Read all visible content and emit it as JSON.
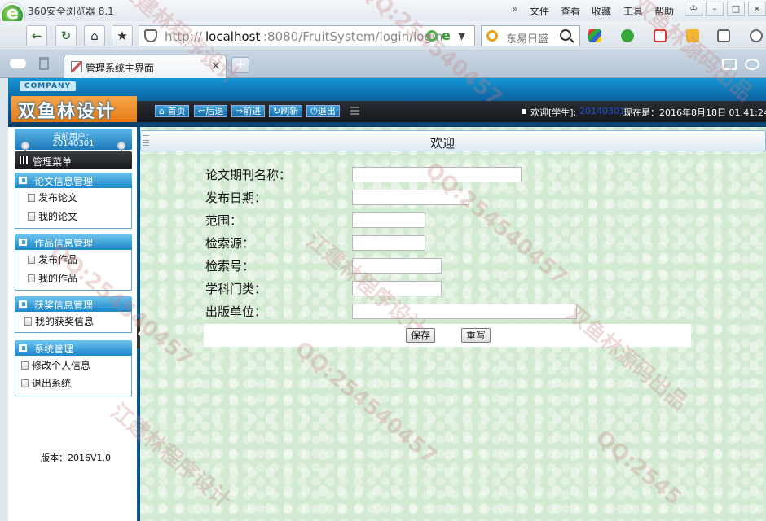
{
  "browser": {
    "name": "360安全浏览器 8.1",
    "menu_more": "»",
    "menu": [
      "文件",
      "查看",
      "收藏",
      "工具",
      "帮助"
    ],
    "url_scheme": "http://",
    "url_host": "localhost",
    "url_path": ":8080/FruitSystem/login/login",
    "search_text": "东易日盛",
    "tab_title": "管理系统主界面",
    "new_tab": "+",
    "tab_close": "×"
  },
  "header": {
    "company": "COMPANY",
    "logo": "双鱼林设计",
    "nav": [
      "首页",
      "后退",
      "前进",
      "刷新",
      "退出"
    ],
    "welcome_label": "欢迎[学生]:",
    "welcome_user": "20140301",
    "now_text": "现在是：2016年8月18日 01:41:24"
  },
  "sidebar": {
    "current_user_label": "当前用户：",
    "current_user_id": "20140301",
    "menu_header": "管理菜单",
    "groups": [
      {
        "title": "论文信息管理",
        "items": [
          "发布论文",
          "我的论文"
        ]
      },
      {
        "title": "作品信息管理",
        "items": [
          "发布作品",
          "我的作品"
        ]
      },
      {
        "title": "获奖信息管理",
        "items": [
          "我的获奖信息"
        ]
      },
      {
        "title": "系统管理",
        "items": [
          "修改个人信息",
          "退出系统"
        ]
      }
    ],
    "version": "版本：2016V1.0"
  },
  "main": {
    "title": "欢迎",
    "form": {
      "fields": [
        {
          "label": "论文期刊名称：",
          "value": ""
        },
        {
          "label": "发布日期：",
          "value": ""
        },
        {
          "label": "范围：",
          "value": ""
        },
        {
          "label": "检索源：",
          "value": ""
        },
        {
          "label": "检索号：",
          "value": ""
        },
        {
          "label": "学科门类：",
          "value": ""
        },
        {
          "label": "出版单位：",
          "value": ""
        }
      ],
      "save_label": "保存",
      "reset_label": "重写"
    }
  },
  "watermarks": [
    "江建林程序设计",
    "QQ:254540457",
    "双鱼林源码出品",
    "QQ:254540457",
    "江建林程序设计",
    "QQ:254540457",
    "双鱼林源码出品",
    "QQ:254540457",
    "江建林程序设计",
    "QQ:2545"
  ]
}
